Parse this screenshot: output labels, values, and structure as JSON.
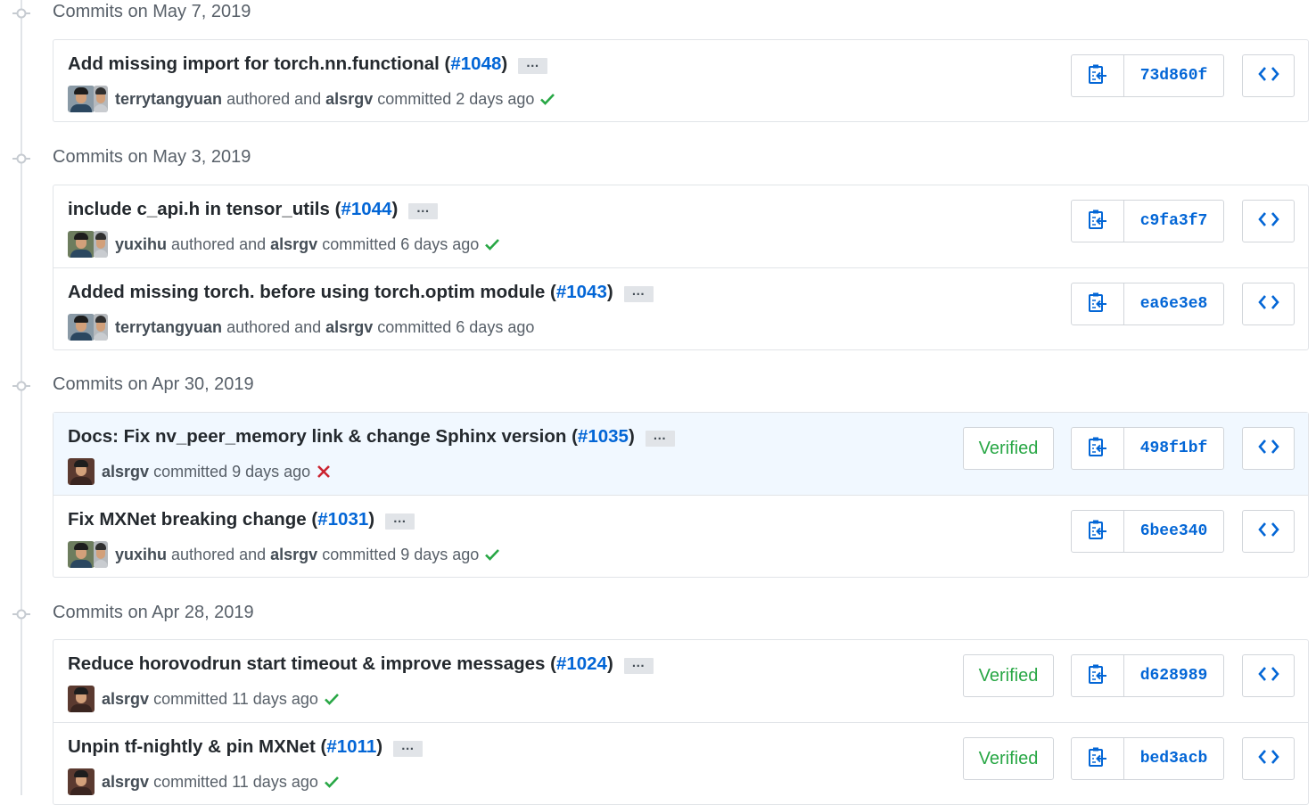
{
  "groups": [
    {
      "title": "Commits on May 7, 2019",
      "commits": [
        {
          "msg": "Add missing import for torch.nn.functional",
          "pr": "#1048",
          "author": "terrytangyuan",
          "committer": "alsrgv",
          "authored_text": "authored and",
          "committed_text": "committed",
          "time": "2 days ago",
          "status": "success",
          "sha": "73d860f",
          "verified": null
        }
      ]
    },
    {
      "title": "Commits on May 3, 2019",
      "commits": [
        {
          "msg": "include c_api.h in tensor_utils",
          "pr": "#1044",
          "author": "yuxihu",
          "committer": "alsrgv",
          "authored_text": "authored and",
          "committed_text": "committed",
          "time": "6 days ago",
          "status": "success",
          "sha": "c9fa3f7",
          "verified": null
        },
        {
          "msg": "Added missing torch. before using torch.optim module",
          "pr": "#1043",
          "author": "terrytangyuan",
          "committer": "alsrgv",
          "authored_text": "authored and",
          "committed_text": "committed",
          "time": "6 days ago",
          "status": "none",
          "sha": "ea6e3e8",
          "verified": null
        }
      ]
    },
    {
      "title": "Commits on Apr 30, 2019",
      "commits": [
        {
          "msg": "Docs: Fix nv_peer_memory link & change Sphinx version",
          "pr": "#1035",
          "author": null,
          "committer": "alsrgv",
          "committed_text": "committed",
          "time": "9 days ago",
          "status": "failure",
          "sha": "498f1bf",
          "verified": "Verified"
        },
        {
          "msg": "Fix MXNet breaking change",
          "pr": "#1031",
          "author": "yuxihu",
          "committer": "alsrgv",
          "authored_text": "authored and",
          "committed_text": "committed",
          "time": "9 days ago",
          "status": "success",
          "sha": "6bee340",
          "verified": null
        }
      ]
    },
    {
      "title": "Commits on Apr 28, 2019",
      "commits": [
        {
          "msg": "Reduce horovodrun start timeout & improve messages",
          "pr": "#1024",
          "author": null,
          "committer": "alsrgv",
          "committed_text": "committed",
          "time": "11 days ago",
          "status": "success",
          "sha": "d628989",
          "verified": "Verified"
        },
        {
          "msg": "Unpin tf-nightly & pin MXNet",
          "pr": "#1011",
          "author": null,
          "committer": "alsrgv",
          "committed_text": "committed",
          "time": "11 days ago",
          "status": "success",
          "sha": "bed3acb",
          "verified": "Verified"
        }
      ]
    }
  ],
  "ellipsis": "…",
  "icons": {
    "timeline": "git-commit-icon",
    "success": "check-icon",
    "failure": "x-icon",
    "copy": "clippy-icon",
    "browse": "code-icon"
  },
  "colors": {
    "link": "#0366d6",
    "success": "#28a745",
    "failure": "#cb2431",
    "muted": "#586069",
    "border": "#e1e4e8",
    "highlight": "#f1f8ff"
  }
}
